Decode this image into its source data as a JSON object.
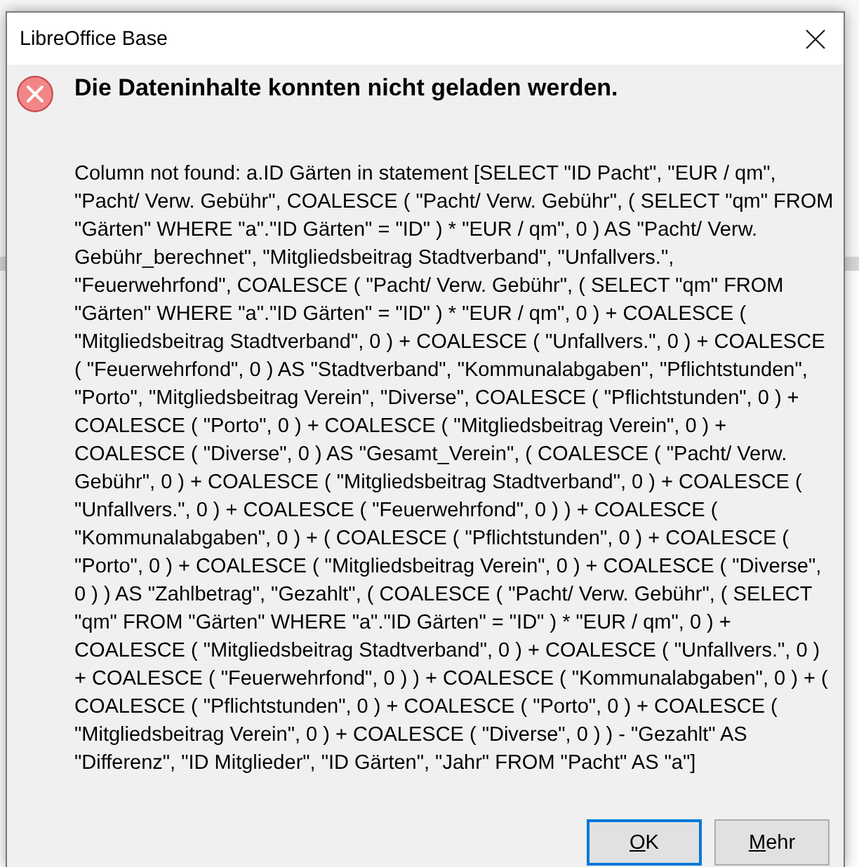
{
  "window": {
    "title": "LibreOffice Base"
  },
  "message": {
    "kind": "error",
    "heading": "Die Dateninhalte konnten nicht geladen werden.",
    "detail": "Column not found: a.ID Gärten in statement [SELECT \"ID Pacht\", \"EUR / qm\", \"Pacht/ Verw. Gebühr\", COALESCE ( \"Pacht/ Verw. Gebühr\", ( SELECT \"qm\" FROM \"Gärten\" WHERE \"a\".\"ID Gärten\" = \"ID\" ) * \"EUR / qm\", 0 ) AS \"Pacht/ Verw. Gebühr_berechnet\", \"Mitgliedsbeitrag Stadtverband\", \"Unfallvers.\", \"Feuerwehrfond\", COALESCE ( \"Pacht/ Verw. Gebühr\", ( SELECT \"qm\" FROM \"Gärten\" WHERE \"a\".\"ID Gärten\" = \"ID\" ) * \"EUR / qm\", 0 ) + COALESCE ( \"Mitgliedsbeitrag Stadtverband\", 0 ) + COALESCE ( \"Unfallvers.\", 0 ) + COALESCE ( \"Feuerwehrfond\", 0 ) AS \"Stadtverband\", \"Kommunalabgaben\", \"Pflichtstunden\", \"Porto\", \"Mitgliedsbeitrag Verein\", \"Diverse\", COALESCE ( \"Pflichtstunden\", 0 ) + COALESCE ( \"Porto\", 0 ) + COALESCE ( \"Mitgliedsbeitrag Verein\", 0 ) + COALESCE ( \"Diverse\", 0 ) AS \"Gesamt_Verein\", ( COALESCE ( \"Pacht/ Verw. Gebühr\", 0 ) + COALESCE ( \"Mitgliedsbeitrag Stadtverband\", 0 ) + COALESCE ( \"Unfallvers.\", 0 ) + COALESCE ( \"Feuerwehrfond\", 0 ) ) + COALESCE ( \"Kommunalabgaben\", 0 ) + ( COALESCE ( \"Pflichtstunden\", 0 ) + COALESCE ( \"Porto\", 0 ) + COALESCE ( \"Mitgliedsbeitrag Verein\", 0 ) + COALESCE ( \"Diverse\", 0 ) ) AS \"Zahlbetrag\", \"Gezahlt\", ( COALESCE ( \"Pacht/ Verw. Gebühr\", ( SELECT \"qm\" FROM \"Gärten\" WHERE \"a\".\"ID Gärten\" = \"ID\" ) * \"EUR / qm\", 0 ) + COALESCE ( \"Mitgliedsbeitrag Stadtverband\", 0 ) + COALESCE ( \"Unfallvers.\", 0 ) + COALESCE ( \"Feuerwehrfond\", 0 ) ) + COALESCE ( \"Kommunalabgaben\", 0 ) + ( COALESCE ( \"Pflichtstunden\", 0 ) + COALESCE ( \"Porto\", 0 ) + COALESCE ( \"Mitgliedsbeitrag Verein\", 0 ) + COALESCE ( \"Diverse\", 0 ) ) - \"Gezahlt\" AS \"Differenz\", \"ID Mitglieder\", \"ID Gärten\", \"Jahr\" FROM \"Pacht\" AS \"a\"]"
  },
  "buttons": [
    {
      "label": "OK",
      "default": true,
      "mnemonic": true
    },
    {
      "label": "Mehr",
      "default": false,
      "mnemonic": true
    }
  ]
}
